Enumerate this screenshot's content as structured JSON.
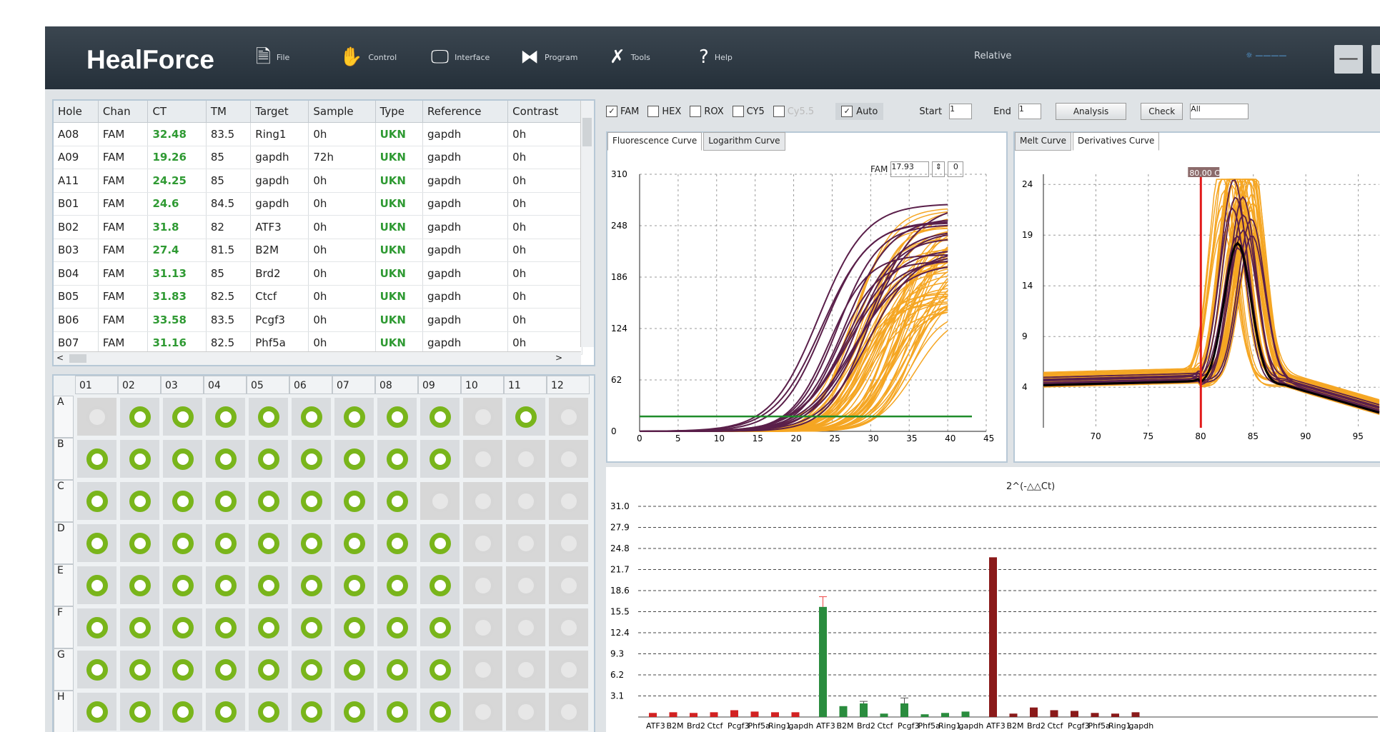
{
  "app": {
    "brand": "HealForce",
    "menu": [
      {
        "icon": "file-icon",
        "glyph": "🗎",
        "label": "File"
      },
      {
        "icon": "hand-icon",
        "glyph": "✋",
        "label": "Control"
      },
      {
        "icon": "monitor-icon",
        "glyph": "🖵",
        "label": "Interface"
      },
      {
        "icon": "program-icon",
        "glyph": "⧓",
        "label": "Program"
      },
      {
        "icon": "tools-icon",
        "glyph": "✗",
        "label": "Tools"
      },
      {
        "icon": "help-icon",
        "glyph": "?",
        "label": "Help"
      }
    ],
    "center_title": "Relative",
    "minimize_glyph": "—"
  },
  "table": {
    "columns": [
      "Hole",
      "Chan",
      "CT",
      "TM",
      "Target",
      "Sample",
      "Type",
      "Reference",
      "Contrast"
    ],
    "rows": [
      [
        "A08",
        "FAM",
        "32.48",
        "83.5",
        "Ring1",
        "0h",
        "UKN",
        "gapdh",
        "0h"
      ],
      [
        "A09",
        "FAM",
        "19.26",
        "85",
        "gapdh",
        "72h",
        "UKN",
        "gapdh",
        "0h"
      ],
      [
        "A11",
        "FAM",
        "24.25",
        "85",
        "gapdh",
        "0h",
        "UKN",
        "gapdh",
        "0h"
      ],
      [
        "B01",
        "FAM",
        "24.6",
        "84.5",
        "gapdh",
        "0h",
        "UKN",
        "gapdh",
        "0h"
      ],
      [
        "B02",
        "FAM",
        "31.8",
        "82",
        "ATF3",
        "0h",
        "UKN",
        "gapdh",
        "0h"
      ],
      [
        "B03",
        "FAM",
        "27.4",
        "81.5",
        "B2M",
        "0h",
        "UKN",
        "gapdh",
        "0h"
      ],
      [
        "B04",
        "FAM",
        "31.13",
        "85",
        "Brd2",
        "0h",
        "UKN",
        "gapdh",
        "0h"
      ],
      [
        "B05",
        "FAM",
        "31.83",
        "82.5",
        "Ctcf",
        "0h",
        "UKN",
        "gapdh",
        "0h"
      ],
      [
        "B06",
        "FAM",
        "33.58",
        "83.5",
        "Pcgf3",
        "0h",
        "UKN",
        "gapdh",
        "0h"
      ],
      [
        "B07",
        "FAM",
        "31.16",
        "82.5",
        "Phf5a",
        "0h",
        "UKN",
        "gapdh",
        "0h"
      ]
    ],
    "scroll_left": "<",
    "scroll_right": ">"
  },
  "plate": {
    "columns": [
      "01",
      "02",
      "03",
      "04",
      "05",
      "06",
      "07",
      "08",
      "09",
      "10",
      "11",
      "12"
    ],
    "rows": [
      "A",
      "B",
      "C",
      "D",
      "E",
      "F",
      "G",
      "H"
    ],
    "active": [
      [
        0,
        1,
        1,
        1,
        1,
        1,
        1,
        1,
        1,
        0,
        1,
        0
      ],
      [
        1,
        1,
        1,
        1,
        1,
        1,
        1,
        1,
        1,
        0,
        0,
        0
      ],
      [
        1,
        1,
        1,
        1,
        1,
        1,
        1,
        1,
        0,
        0,
        0,
        0
      ],
      [
        1,
        1,
        1,
        1,
        1,
        1,
        1,
        1,
        1,
        0,
        0,
        0
      ],
      [
        1,
        1,
        1,
        1,
        1,
        1,
        1,
        1,
        1,
        0,
        0,
        0
      ],
      [
        1,
        1,
        1,
        1,
        1,
        1,
        1,
        1,
        1,
        0,
        0,
        0
      ],
      [
        1,
        1,
        1,
        1,
        1,
        1,
        1,
        1,
        1,
        0,
        0,
        0
      ],
      [
        1,
        1,
        1,
        1,
        1,
        1,
        1,
        1,
        1,
        0,
        0,
        0
      ]
    ]
  },
  "toolbar": {
    "channels": [
      {
        "label": "FAM",
        "checked": true
      },
      {
        "label": "HEX",
        "checked": false
      },
      {
        "label": "ROX",
        "checked": false
      },
      {
        "label": "CY5",
        "checked": false
      },
      {
        "label": "Cy5.5",
        "checked": false
      }
    ],
    "auto_label": "Auto",
    "start_label": "Start",
    "start_value": "1",
    "end_label": "End",
    "end_value": "1",
    "analysis_label": "Analysis",
    "check_label": "Check",
    "check_value": "All"
  },
  "fluor": {
    "tabs": [
      "Fluorescence Curve",
      "Logarithm Curve"
    ],
    "fam_label": "FAM",
    "fam_value": "17.93",
    "fam_extra": "0",
    "chart_data": {
      "type": "line",
      "yticks": [
        310,
        248,
        186,
        124,
        62,
        0
      ],
      "xticks": [
        0,
        5,
        10,
        15,
        20,
        25,
        30,
        35,
        40,
        45
      ],
      "xlim": [
        0,
        45
      ],
      "ylim": [
        0,
        310
      ],
      "threshold": 17.93,
      "series_colors": [
        "#5a1f4a",
        "#f5a623"
      ]
    }
  },
  "melt": {
    "tabs": [
      "Melt Curve",
      "Derivatives Curve"
    ],
    "marker_label": "80.00 C",
    "chart_data": {
      "type": "line",
      "yticks": [
        24,
        19,
        14,
        9,
        4
      ],
      "xticks": [
        70,
        75,
        80,
        85,
        90,
        95
      ],
      "xlim": [
        65,
        97
      ],
      "ylim": [
        0,
        25
      ],
      "marker_x": 80,
      "series_colors": [
        "#5a1f4a",
        "#f5a623",
        "#000000"
      ]
    }
  },
  "bars": {
    "title": "2^(-△△Ct)",
    "chart_data": {
      "type": "bar",
      "yticks": [
        31.0,
        27.9,
        24.8,
        21.7,
        18.6,
        15.5,
        12.4,
        9.3,
        6.2,
        3.1
      ],
      "ylim": [
        0,
        31.0
      ],
      "groups": [
        {
          "color": "#d22222",
          "categories": [
            "ATF3",
            "B2M",
            "Brd2",
            "Ctcf",
            "Pcgf3",
            "Phf5a",
            "Ring1",
            "gapdh"
          ],
          "values": [
            0.6,
            0.7,
            0.6,
            0.7,
            1.0,
            0.8,
            0.7,
            0.7
          ],
          "errors": [
            0,
            0,
            0,
            0,
            0,
            0,
            0,
            0
          ]
        },
        {
          "color": "#2a8c3e",
          "categories": [
            "ATF3",
            "B2M",
            "Brd2",
            "Ctcf",
            "Pcgf3",
            "Phf5a",
            "Ring1",
            "gapdh"
          ],
          "values": [
            16.2,
            1.6,
            2.0,
            0.5,
            2.0,
            0.4,
            0.6,
            0.8
          ],
          "errors": [
            1.5,
            0,
            0.3,
            0,
            0.8,
            0,
            0,
            0
          ]
        },
        {
          "color": "#8a1a1a",
          "categories": [
            "ATF3",
            "B2M",
            "Brd2",
            "Ctcf",
            "Pcgf3",
            "Phf5a",
            "Ring1",
            "gapdh"
          ],
          "values": [
            23.5,
            0.5,
            1.4,
            1.0,
            0.9,
            0.6,
            0.5,
            0.7
          ],
          "errors": [
            0,
            0,
            0,
            0,
            0,
            0,
            0,
            0
          ]
        }
      ],
      "xlabels": [
        "ATF3",
        "B2M",
        "Brd2",
        "Ctcf",
        "Pcgf3",
        "Phf5a",
        "Ring1",
        "gapdh",
        "ATF3",
        "B2M",
        "Brd2",
        "Ctcf",
        "Pcgf3",
        "Phf5a",
        "Ring1",
        "gapdh",
        "ATF3",
        "B2M",
        "Brd2",
        "Ctcf",
        "Pcgf3",
        "Phf5a",
        "Ring1",
        "gapdh"
      ]
    }
  }
}
